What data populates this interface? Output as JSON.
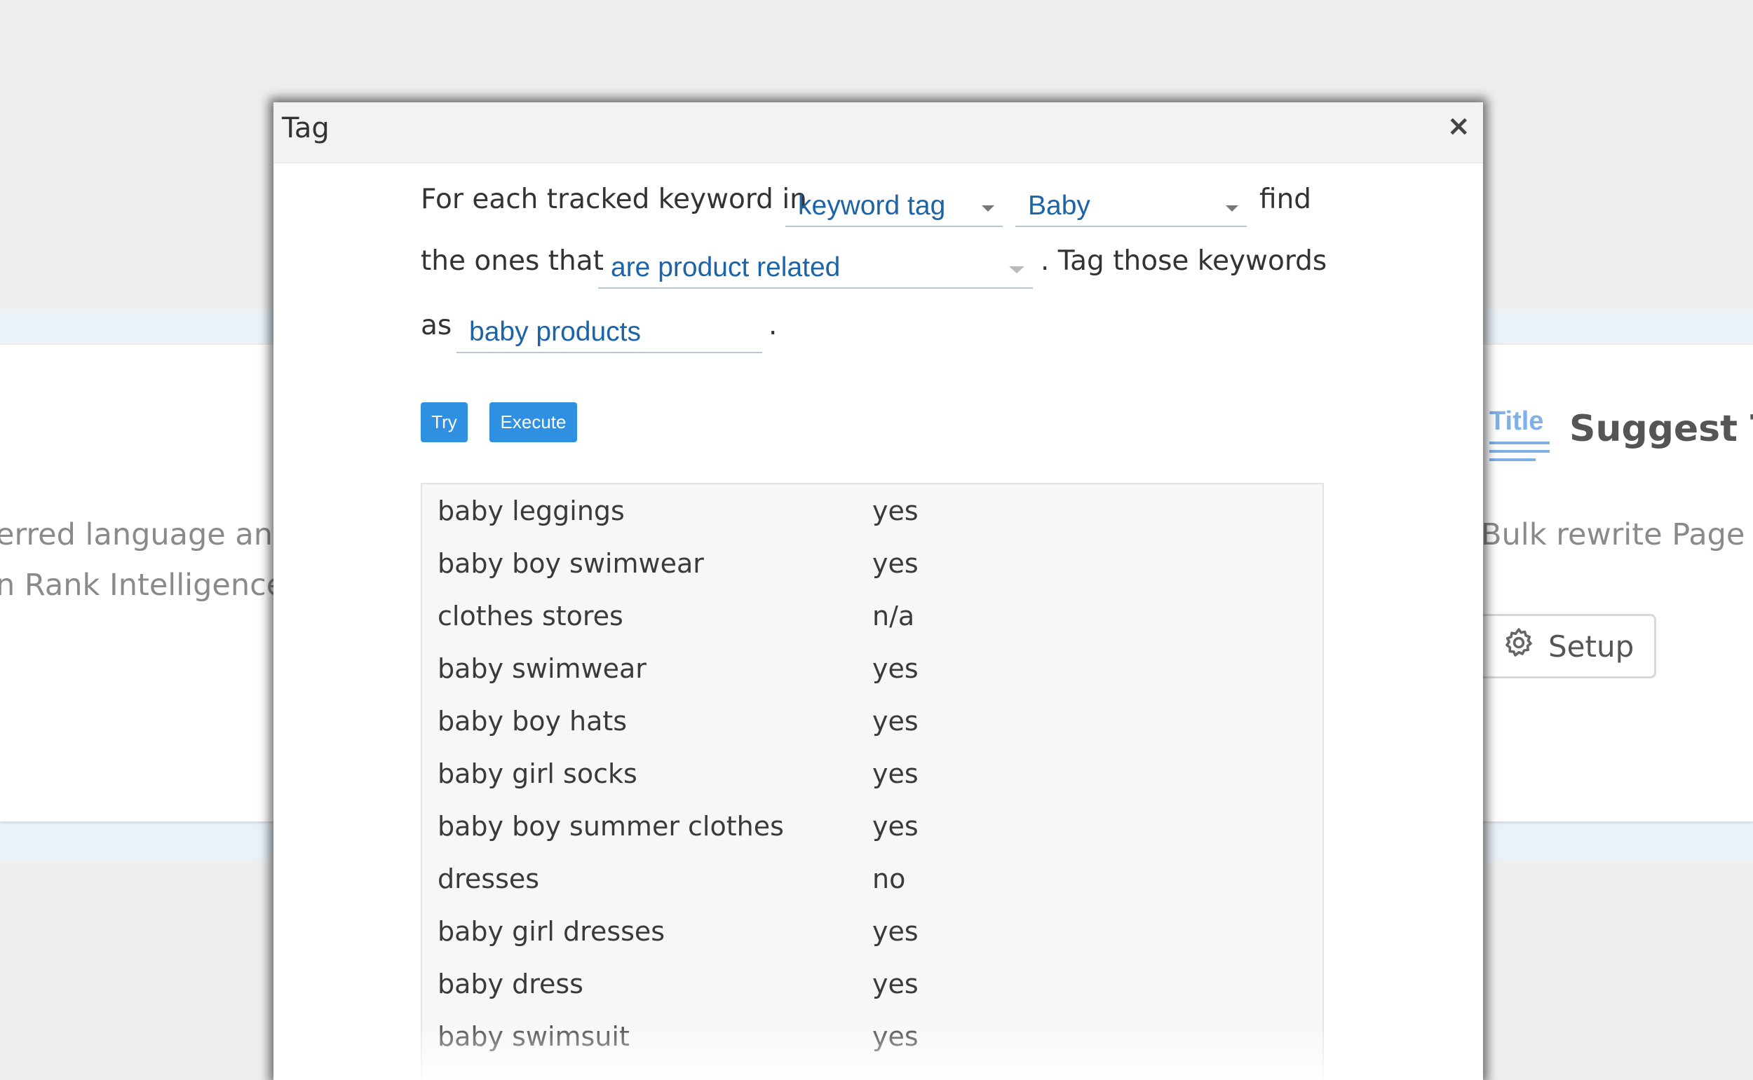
{
  "background": {
    "left_lines": [
      "erred language and",
      "n Rank Intelligence."
    ],
    "right_card": {
      "icon_word": "Title",
      "heading": "Suggest Tit",
      "subtitle": "Bulk rewrite Page T",
      "setup_label": "Setup"
    }
  },
  "modal": {
    "title": "Tag",
    "close_symbol": "×",
    "sentence": {
      "part1": "For each tracked keyword in",
      "filter_type": "keyword tag",
      "filter_value": "Baby",
      "part2": "find",
      "part3": "the ones that",
      "condition": "are product related",
      "part4": ". Tag those keywords",
      "part5": "as",
      "tag_name": "baby products",
      "period": "."
    },
    "buttons": {
      "try": "Try",
      "execute": "Execute"
    },
    "results": [
      {
        "keyword": "baby leggings",
        "result": "yes"
      },
      {
        "keyword": "baby boy swimwear",
        "result": "yes"
      },
      {
        "keyword": "clothes stores",
        "result": "n/a"
      },
      {
        "keyword": "baby swimwear",
        "result": "yes"
      },
      {
        "keyword": "baby boy hats",
        "result": "yes"
      },
      {
        "keyword": "baby girl socks",
        "result": "yes"
      },
      {
        "keyword": "baby boy summer clothes",
        "result": "yes"
      },
      {
        "keyword": "dresses",
        "result": "no"
      },
      {
        "keyword": "baby girl dresses",
        "result": "yes"
      },
      {
        "keyword": "baby dress",
        "result": "yes"
      },
      {
        "keyword": "baby swimsuit",
        "result": "yes"
      }
    ]
  }
}
